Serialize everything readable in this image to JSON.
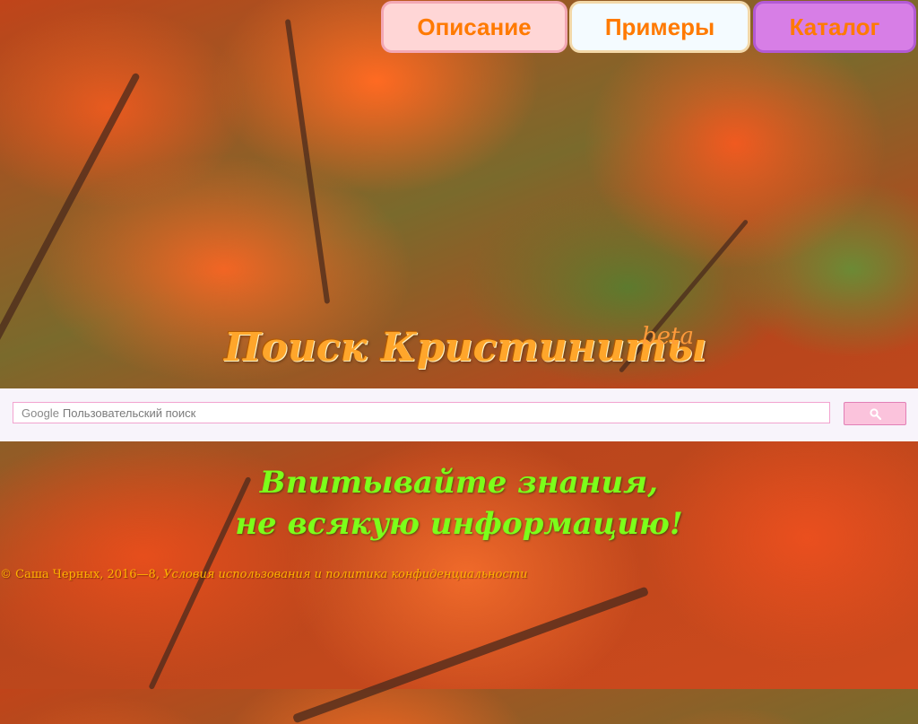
{
  "nav": {
    "description_label": "Описание",
    "examples_label": "Примеры",
    "catalog_label": "Каталог"
  },
  "header": {
    "title": "Поиск Кристиниты",
    "badge": "beta"
  },
  "search": {
    "google_label": "Google",
    "placeholder": "Пользовательский поиск",
    "button_icon": "search-icon"
  },
  "slogan": {
    "line1": "Впитывайте знания,",
    "line2": "не всякую информацию!"
  },
  "footer": {
    "copyright": "© Саша Черных, 2016—8, ",
    "terms_link": "Условия использования и политика конфиденциальности"
  },
  "colors": {
    "nav_text": "#ff7a00",
    "title": "#ffa62b",
    "slogan": "#7cff1a",
    "footer": "#ffb300"
  }
}
